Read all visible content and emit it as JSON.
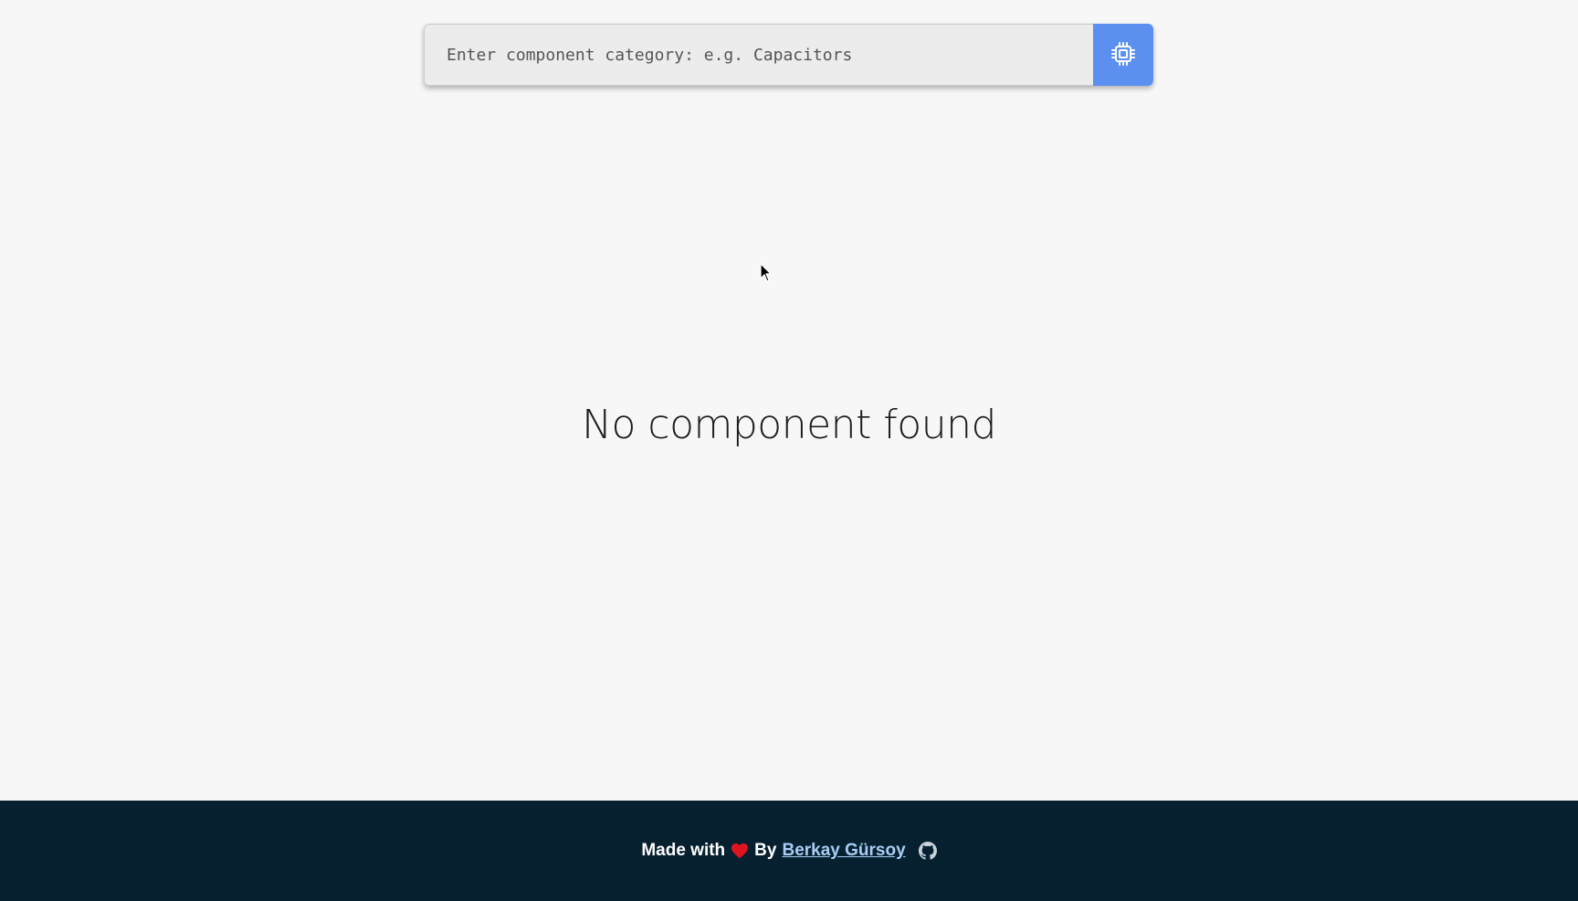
{
  "search": {
    "placeholder": "Enter component category: e.g. Capacitors",
    "value": "",
    "button_icon": "chip-icon",
    "button_color": "#5b8ff0"
  },
  "main": {
    "empty_message": "No component found"
  },
  "footer": {
    "made_with": "Made with",
    "heart_icon": "heart-icon",
    "heart_color": "#e0141e",
    "by": "By",
    "author": "Berkay Gürsoy",
    "github_icon": "github-icon",
    "background": "#06202f",
    "link_color": "#a9cdf5"
  }
}
